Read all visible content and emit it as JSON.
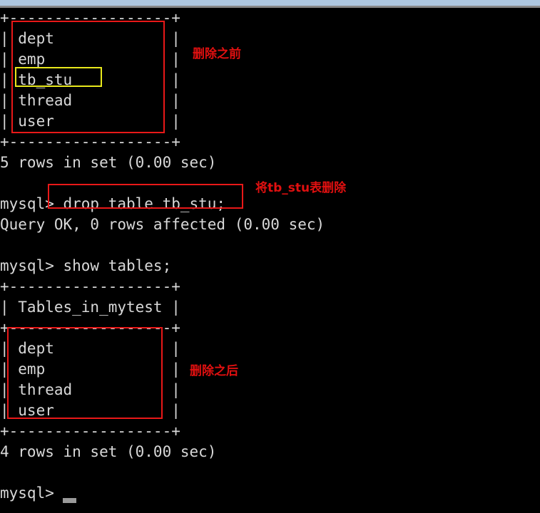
{
  "window": {
    "titlebar_color": "#aec7e0",
    "terminal_background": "#000000",
    "terminal_foreground": "#dcdcdc"
  },
  "theme": {
    "annotation_red": "#e01010",
    "annotation_box_red": "#e81818",
    "annotation_box_yellow": "#e8e81c",
    "table_border_color": "#6f8fa8",
    "prompt_arrow_color": "#c9a227",
    "cursor_color": "#9a9a9a"
  },
  "terminal": {
    "lines": [
      {
        "id": "line-rule-top-1",
        "text": "+------------------+"
      },
      {
        "id": "line-table1-dept",
        "text": "| dept             |"
      },
      {
        "id": "line-table1-emp",
        "text": "| emp              |"
      },
      {
        "id": "line-table1-tbstu",
        "text": "| tb_stu           |"
      },
      {
        "id": "line-table1-thread",
        "text": "| thread           |"
      },
      {
        "id": "line-table1-user",
        "text": "| user             |"
      },
      {
        "id": "line-rule-top-2",
        "text": "+------------------+"
      },
      {
        "id": "line-rows-5",
        "text": "5 rows in set (0.00 sec)"
      },
      {
        "id": "line-blank-1",
        "text": ""
      },
      {
        "id": "line-cmd-drop",
        "text": "mysql> drop table tb_stu;"
      },
      {
        "id": "line-query-ok",
        "text": "Query OK, 0 rows affected (0.00 sec)"
      },
      {
        "id": "line-blank-2",
        "text": ""
      },
      {
        "id": "line-cmd-show",
        "text": "mysql> show tables;"
      },
      {
        "id": "line-rule-mid-1",
        "text": "+------------------+"
      },
      {
        "id": "line-table2-header",
        "text": "| Tables_in_mytest |"
      },
      {
        "id": "line-rule-mid-2",
        "text": "+------------------+"
      },
      {
        "id": "line-table2-dept",
        "text": "| dept             |"
      },
      {
        "id": "line-table2-emp",
        "text": "| emp              |"
      },
      {
        "id": "line-table2-thread",
        "text": "| thread           |"
      },
      {
        "id": "line-table2-user",
        "text": "| user             |"
      },
      {
        "id": "line-rule-mid-3",
        "text": "+------------------+"
      },
      {
        "id": "line-rows-4",
        "text": "4 rows in set (0.00 sec)"
      },
      {
        "id": "line-blank-3",
        "text": ""
      },
      {
        "id": "line-prompt-final",
        "text": "mysql>"
      }
    ],
    "column_header": "Tables_in_mytest",
    "tables_before": [
      "dept",
      "emp",
      "tb_stu",
      "thread",
      "user"
    ],
    "tables_after": [
      "dept",
      "emp",
      "thread",
      "user"
    ],
    "rows_before_text": "5 rows in set (0.00 sec)",
    "rows_after_text": "4 rows in set (0.00 sec)",
    "drop_command": "mysql> drop table tb_stu;",
    "drop_result": "Query OK, 0 rows affected (0.00 sec)",
    "show_command": "mysql> show tables;",
    "final_prompt": "mysql>"
  },
  "annotations": {
    "before_label": "删除之前",
    "action_label": "将tb_stu表删除",
    "after_label": "删除之后"
  }
}
